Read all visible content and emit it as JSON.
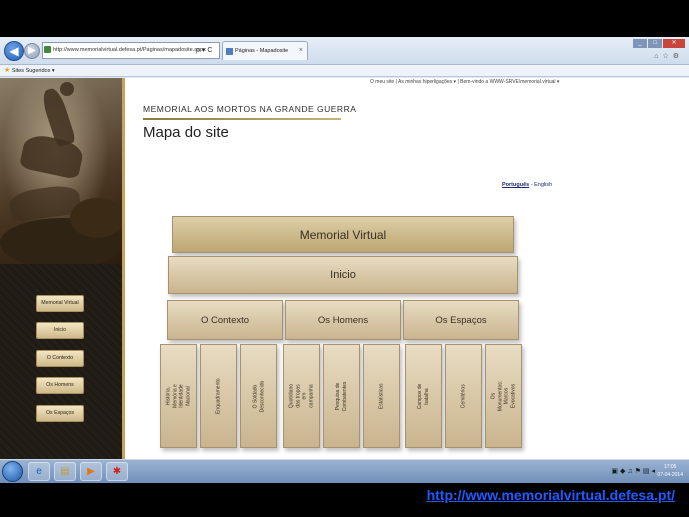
{
  "browser": {
    "address": "http://www.memorialvirtual.defesa.pt/Paginas/mapadosite.aspx",
    "address_tools": "ρ ▾ C",
    "tab_title": "Páginas - Mapadosite",
    "favorites_label": "Sites Sugeridos ▾"
  },
  "top_links": "O meu site  |  As minhas hiperligações ▾  |  Bem-vindo a WWW-SRVE\\memorial.virtual ▾",
  "header": {
    "site_name": "MEMORIAL AOS MORTOS NA GRANDE GUERRA",
    "page_title": "Mapa do site"
  },
  "language": {
    "pt": "Português",
    "sep": " - ",
    "en": "English"
  },
  "side_nav": [
    "Memorial Virtual",
    "Inicio",
    "O Contexto",
    "Os Homens",
    "Os Espaços"
  ],
  "sitemap": {
    "root": "Memorial Virtual",
    "home": "Inicio",
    "sections": [
      "O Contexto",
      "Os Homens",
      "Os Espaços"
    ],
    "subpages": [
      "História, Memória e Identidade Nacional",
      "Enquadramento",
      "O Soldado Desconhecido",
      "Quotidiano das tropas em campanha",
      "Pesquisa de Combatentes",
      "Estatísticas",
      "Campos de batalha",
      "Cemitérios",
      "Os Monumentos: Marcos Evocativos"
    ]
  },
  "taskbar": {
    "time": "17:05",
    "date": "07-04-2014"
  },
  "caption_url": "http://www.memorialvirtual.defesa.pt/"
}
